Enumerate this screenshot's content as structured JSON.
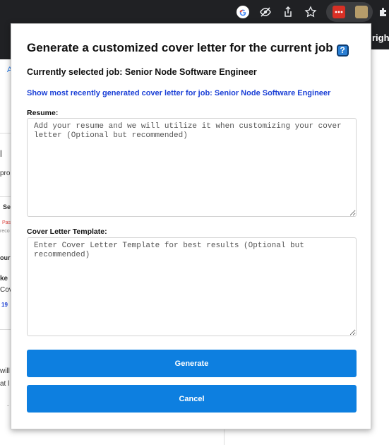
{
  "browser": {
    "background_text_fragments": [
      "right",
      "A",
      "l",
      "pro",
      "Se",
      "Pas",
      "reco",
      "our",
      "ke",
      "Cov",
      "19",
      "will",
      "at l"
    ]
  },
  "modal": {
    "title": "Generate a customized cover letter for the current job",
    "help_icon_glyph": "?",
    "job_line": "Currently selected job: Senior Node Software Engineer",
    "recent_link": "Show most recently generated cover letter for job: Senior Node Software Engineer",
    "resume": {
      "label": "Resume:",
      "value": "",
      "placeholder": "Add your resume and we will utilize it when customizing your cover letter (Optional but recommended)"
    },
    "template": {
      "label": "Cover Letter Template:",
      "value": "",
      "placeholder": "Enter Cover Letter Template for best results (Optional but recommended)"
    },
    "generate_label": "Generate",
    "cancel_label": "Cancel"
  },
  "colors": {
    "button": "#0d7fe0",
    "link": "#1a3fd6",
    "toolbar": "#202124"
  }
}
